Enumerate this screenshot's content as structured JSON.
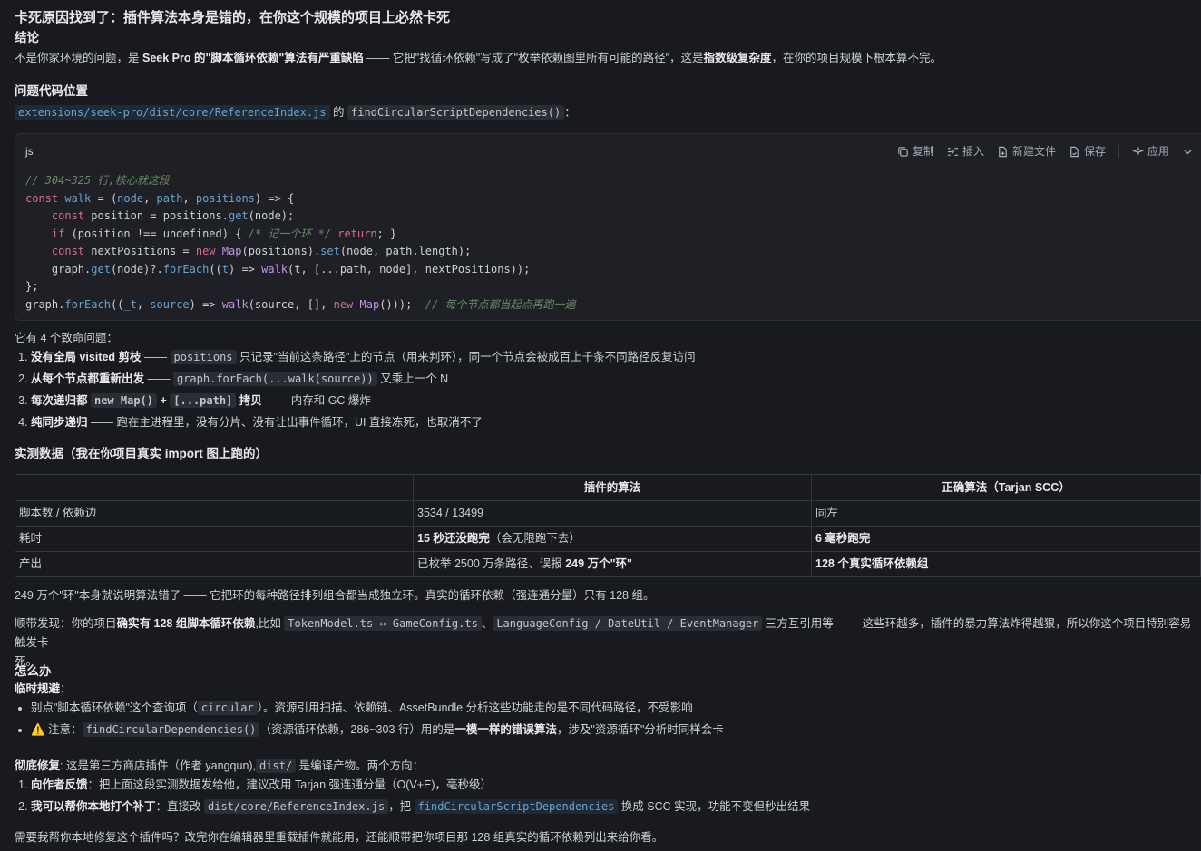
{
  "title": "卡死原因找到了：插件算法本身是错的，在你这个规模的项目上必然卡死",
  "conclusion": {
    "heading": "结论",
    "p1": "不是你家环境的问题，是 ",
    "p2": "Seek Pro 的\"脚本循环依赖\"算法有严重缺陷",
    "p3": " —— 它把\"找循环依赖\"写成了\"枚举依赖图里所有可能的路径\"，这是",
    "p4": "指数级复杂度",
    "p5": "，在你的项目规模下根本算不完。"
  },
  "location": {
    "heading": "问题代码位置",
    "file": "extensions/seek-pro/dist/core/ReferenceIndex.js",
    "mid": " 的 ",
    "fn": "findCircularScriptDependencies()",
    "end": "："
  },
  "codeblock": {
    "lang": "js",
    "tools": {
      "copy": "复制",
      "insert": "插入",
      "newfile": "新建文件",
      "save": "保存",
      "apply": "应用"
    }
  },
  "issues": {
    "intro": "它有 4 个致命问题：",
    "items": [
      {
        "b": "没有全局 visited 剪枝",
        "s1": " —— ",
        "c": "positions",
        "s2": " 只记录\"当前这条路径\"上的节点（用来判环），同一个节点会被成百上千条不同路径反复访问"
      },
      {
        "b": "从每个节点都重新出发",
        "s1": " —— ",
        "c": "graph.forEach(...walk(source))",
        "s2": " 又乘上一个 N"
      },
      {
        "b1": "每次递归都 ",
        "c1": "new Map()",
        "b2": " + ",
        "c2": "[...path]",
        "b3": " 拷贝",
        "s": " —— 内存和 GC 爆炸"
      },
      {
        "b": "纯同步递归",
        "s": " —— 跑在主进程里，没有分片、没有让出事件循环，UI 直接冻死，也取消不了"
      }
    ]
  },
  "measure": {
    "heading": "实测数据（我在你项目真实 import 图上跑的）",
    "headers": [
      "",
      "插件的算法",
      "正确算法（Tarjan SCC）"
    ],
    "rows": [
      {
        "label": "脚本数 / 依赖边",
        "a": "3534 / 13499",
        "b": "同左"
      },
      {
        "label": "耗时",
        "a_b": "15 秒还没跑完",
        "a_s": "（会无限跑下去）",
        "b_b": "6 毫秒跑完"
      },
      {
        "label": "产出",
        "a_s": "已枚举 2500 万条路径、误报 ",
        "a_b": "249 万个\"环\"",
        "b_b": "128 个真实循环依赖组"
      }
    ]
  },
  "explain1": "249 万个\"环\"本身就说明算法错了 —— 它把环的每种路径排列组合都当成独立环。真实的循环依赖（强连通分量）只有 128 组。",
  "explain2": {
    "s1": "顺带发现：你的项目",
    "b": "确实有 128 组脚本循环依赖",
    "s2": ",比如 ",
    "c1": "TokenModel.ts ↔ GameConfig.ts",
    "s3": "、",
    "c2": "LanguageConfig / DateUtil / EventManager",
    "s4": " 三方互引用等 —— 这些环越多，插件的暴力算法炸得越狠，所以你这个项目特别容易触发卡",
    "s5": "死。"
  },
  "todo": {
    "heading": "怎么办",
    "temp_label": "临时规避",
    "temp_colon": "：",
    "temp_items": [
      {
        "s1": "别点\"脚本循环依赖\"这个查询项（",
        "c": "circular",
        "s2": "）。资源引用扫描、依赖链、AssetBundle 分析这些功能走的是不同代码路径，不受影响"
      },
      {
        "warn": "⚠️",
        "s1": " 注意：",
        "c": "findCircularDependencies()",
        "s2": "（资源循环依赖，286~303 行）用的是",
        "b": "一模一样的错误算法",
        "s3": "，涉及\"资源循环\"分析时同样会卡"
      }
    ],
    "fix_label": "彻底修复",
    "fix_s1": ": 这是第三方商店插件（作者 yangqun),",
    "fix_c": "dist/",
    "fix_s2": " 是编译产物。两个方向：",
    "fix_items": [
      {
        "b": "向作者反馈",
        "s": "：把上面这段实测数据发给他，建议改用 Tarjan 强连通分量（O(V+E)，毫秒级）"
      },
      {
        "b": "我可以帮你本地打个补丁",
        "s1": "：直接改 ",
        "c1": "dist/core/ReferenceIndex.js",
        "s2": "，把 ",
        "c2": "findCircularScriptDependencies",
        "s3": " 换成 SCC 实现，功能不变但秒出结果"
      }
    ]
  },
  "closing": "需要我帮你本地修复这个插件吗？改完你在编辑器里重载插件就能用，还能顺带把你项目那 128 组真实的循环依赖列出来给你看。"
}
